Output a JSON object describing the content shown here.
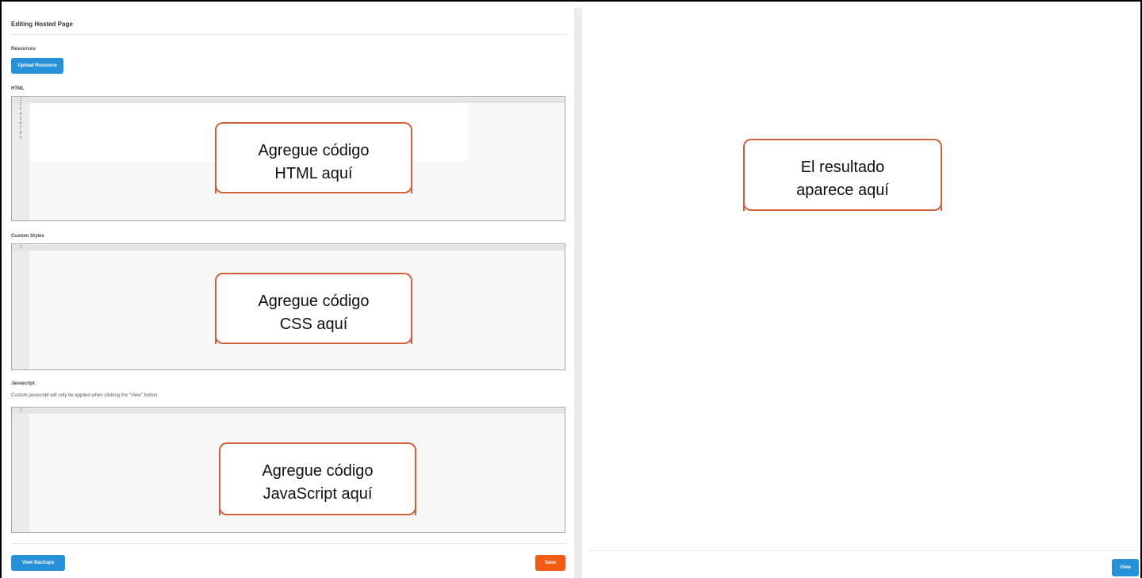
{
  "editor": {
    "page_title": "Editing Hosted Page",
    "resources_label": "Resources",
    "upload_button": "Upload Resource",
    "html_label": "HTML",
    "html_line_numbers": [
      "1",
      "2",
      "3",
      "4",
      "5",
      "6",
      "7",
      "8",
      "9"
    ],
    "styles_label": "Custom Styles",
    "styles_line_numbers": [
      "1"
    ],
    "js_label": "Javascript",
    "js_note": "Custom javascript will only be applied when clicking the \"View\" button.",
    "js_line_numbers": [
      "1"
    ],
    "view_backups_button": "View Backups",
    "save_button": "Save"
  },
  "preview": {
    "view_button": "View"
  },
  "callouts": {
    "html": [
      "Agregue código",
      "HTML aquí"
    ],
    "css": [
      "Agregue código",
      "CSS aquí"
    ],
    "js": [
      "Agregue código",
      "JavaScript aquí"
    ],
    "result": [
      "El resultado",
      "aparece aquí"
    ]
  },
  "colors": {
    "primary_button": "#2690d8",
    "save_button": "#f35a12",
    "callout_border": "#d2603b"
  }
}
